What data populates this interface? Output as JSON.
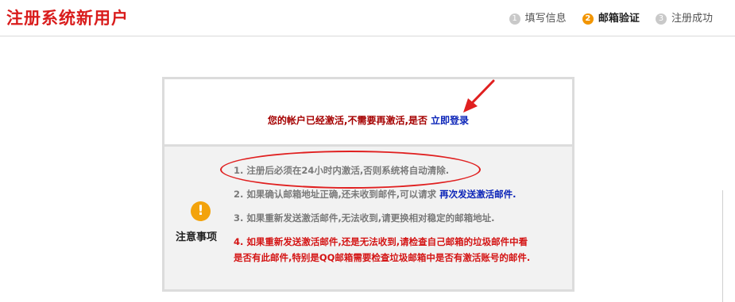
{
  "header": {
    "title": "注册系统新用户",
    "steps": [
      {
        "num": "1",
        "label": "填写信息"
      },
      {
        "num": "2",
        "label": "邮箱验证"
      },
      {
        "num": "3",
        "label": "注册成功"
      }
    ]
  },
  "status": {
    "message": "您的帐户已经激活,不需要再激活,是否",
    "login_link": "立即登录"
  },
  "notice": {
    "label": "注意事项",
    "icon": "warning-icon",
    "items": [
      "1. 注册后必须在24小时内激活,否则系统将自动清除.",
      "2. 如果确认邮箱地址正确,还未收到邮件,可以请求",
      "3. 如果重新发送激活邮件,无法收到,请更换相对稳定的邮箱地址.",
      "4. 如果重新发送激活邮件,还是无法收到,请检查自己邮箱的垃圾邮件中看",
      "是否有此邮件,特别是QQ邮箱需要检查垃圾邮箱中是否有激活账号的邮件."
    ],
    "resend_link": "再次发送激活邮件."
  },
  "colors": {
    "brand_red": "#d91c1c",
    "link_blue": "#0b24b8",
    "active_step": "#f29500"
  }
}
